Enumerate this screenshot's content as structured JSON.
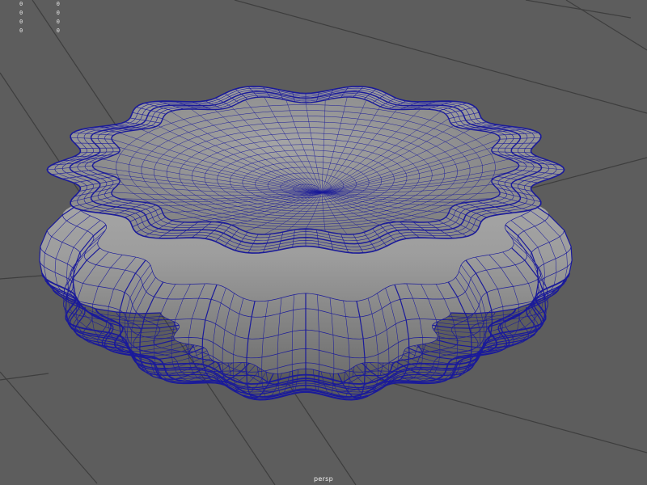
{
  "viewport": {
    "camera_label": "persp",
    "background_color": "#5d5d5d",
    "grid_color": "#3e3e3e",
    "wire_color": "#1a1a9a",
    "surface_color": "#9e9e9e"
  },
  "hud": {
    "rows": [
      {
        "a": "0",
        "b": "0"
      },
      {
        "a": "0",
        "b": "0"
      },
      {
        "a": "0",
        "b": "0"
      },
      {
        "a": "0",
        "b": "0"
      }
    ]
  },
  "scene": {
    "object": "flower-pouf-mesh",
    "petals": 14
  }
}
